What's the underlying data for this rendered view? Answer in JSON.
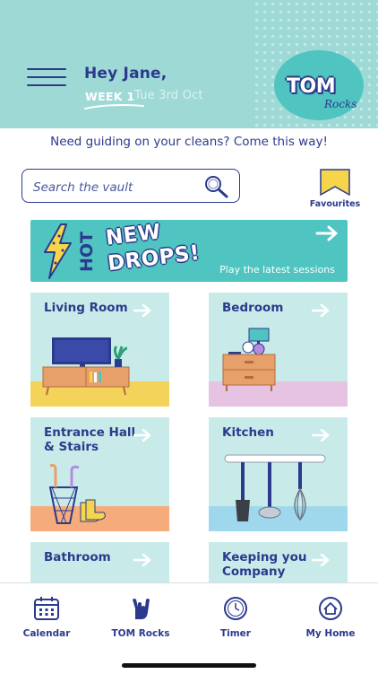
{
  "header": {
    "greeting": "Hey Jane,",
    "week": "WEEK 1",
    "date": "Tue 3rd Oct",
    "logo_text": "TOM",
    "logo_script": "Rocks"
  },
  "guide_text": "Need guiding on your cleans? Come this way!",
  "search": {
    "placeholder": "Search the vault"
  },
  "favourites": {
    "label": "Favourites"
  },
  "banner": {
    "hot": "HOT",
    "line1": "NEW",
    "line2": "DROPS!",
    "subtitle": "Play the latest sessions"
  },
  "rooms": [
    {
      "title": "Living Room"
    },
    {
      "title": "Bedroom"
    },
    {
      "title": "Entrance Hall & Stairs"
    },
    {
      "title": "Kitchen"
    },
    {
      "title": "Bathroom"
    },
    {
      "title": "Keeping you Company"
    }
  ],
  "nav": [
    {
      "label": "Calendar",
      "icon": "calendar-icon"
    },
    {
      "label": "TOM Rocks",
      "icon": "rock-hand-icon"
    },
    {
      "label": "Timer",
      "icon": "timer-icon"
    },
    {
      "label": "My Home",
      "icon": "home-icon"
    }
  ],
  "colors": {
    "header_bg": "#9fd9d6",
    "brand_navy": "#2b3a8c",
    "teal": "#4fc4c1",
    "card_bg": "#c8ebea"
  }
}
